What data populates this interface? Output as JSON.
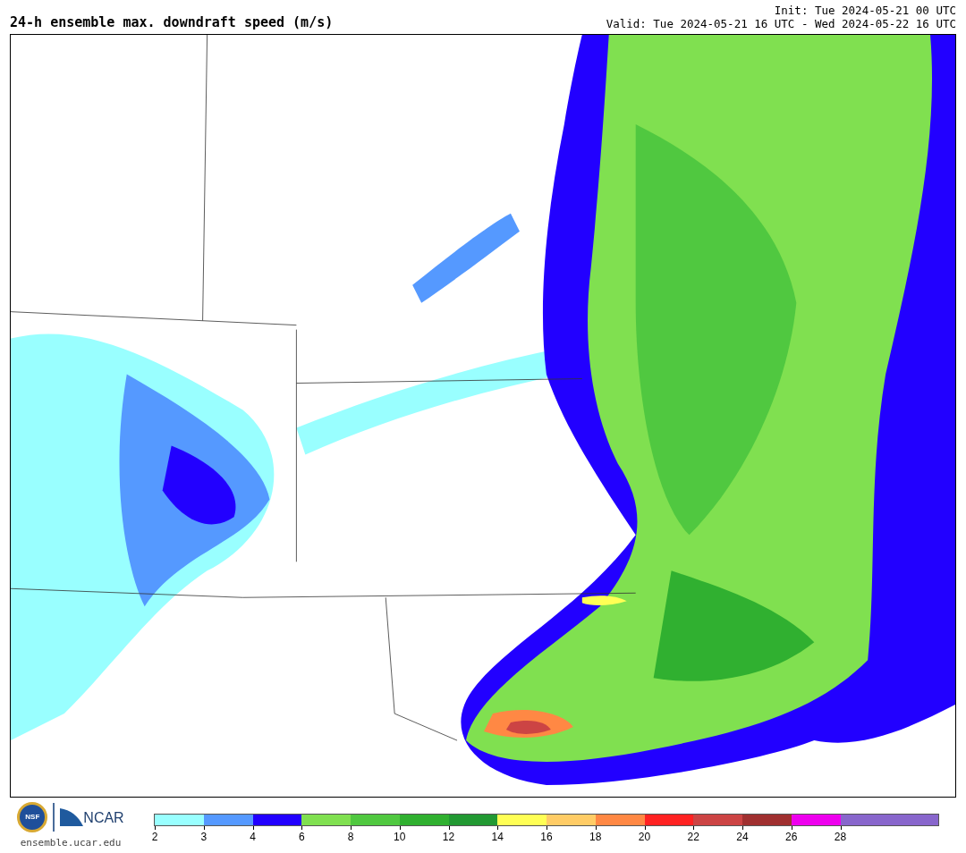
{
  "title": "24-h ensemble max. downdraft speed (m/s)",
  "init": "Init: Tue 2024-05-21 00 UTC",
  "valid": "Valid: Tue 2024-05-21 16 UTC - Wed 2024-05-22 16 UTC",
  "logos": {
    "nsf": "NSF",
    "ncar": "NCAR"
  },
  "site": "ensemble.ucar.edu",
  "colorbar": [
    {
      "label": "2",
      "color": "#99ffff"
    },
    {
      "label": "3",
      "color": "#5599ff"
    },
    {
      "label": "4",
      "color": "#2200ff"
    },
    {
      "label": "6",
      "color": "#80e050"
    },
    {
      "label": "8",
      "color": "#50c840"
    },
    {
      "label": "10",
      "color": "#30b030"
    },
    {
      "label": "12",
      "color": "#229933"
    },
    {
      "label": "14",
      "color": "#ffff55"
    },
    {
      "label": "16",
      "color": "#ffcc66"
    },
    {
      "label": "18",
      "color": "#ff8844"
    },
    {
      "label": "20",
      "color": "#ff2222"
    },
    {
      "label": "22",
      "color": "#cc4444"
    },
    {
      "label": "24",
      "color": "#a03030"
    },
    {
      "label": "26",
      "color": "#ee00ee"
    },
    {
      "label": "28",
      "color": "#8866cc"
    },
    {
      "color": "#8866cc"
    }
  ]
}
